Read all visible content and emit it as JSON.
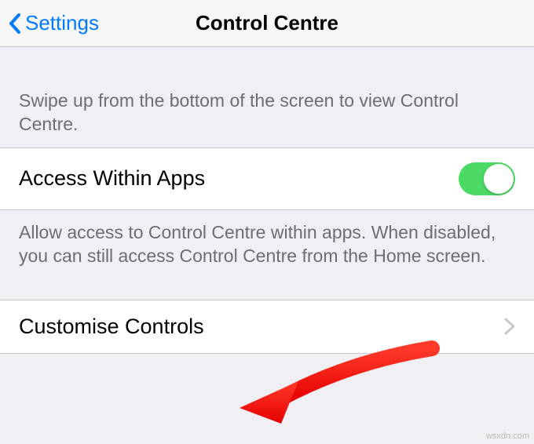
{
  "nav": {
    "back_label": "Settings",
    "title": "Control Centre"
  },
  "sections": {
    "intro_caption": "Swipe up from the bottom of the screen to view Control Centre.",
    "access_row_label": "Access Within Apps",
    "access_toggle_on": true,
    "access_footer": "Allow access to Control Centre within apps. When disabled, you can still access Control Centre from the Home screen.",
    "customise_row_label": "Customise Controls"
  },
  "colors": {
    "tint": "#007aff",
    "toggle_on": "#4cd964",
    "separator": "#c8c7cc",
    "group_bg": "#efeff4",
    "caption_text": "#6d6d72",
    "arrow": "#ff1b0a"
  },
  "watermark": "wsxdn.com"
}
